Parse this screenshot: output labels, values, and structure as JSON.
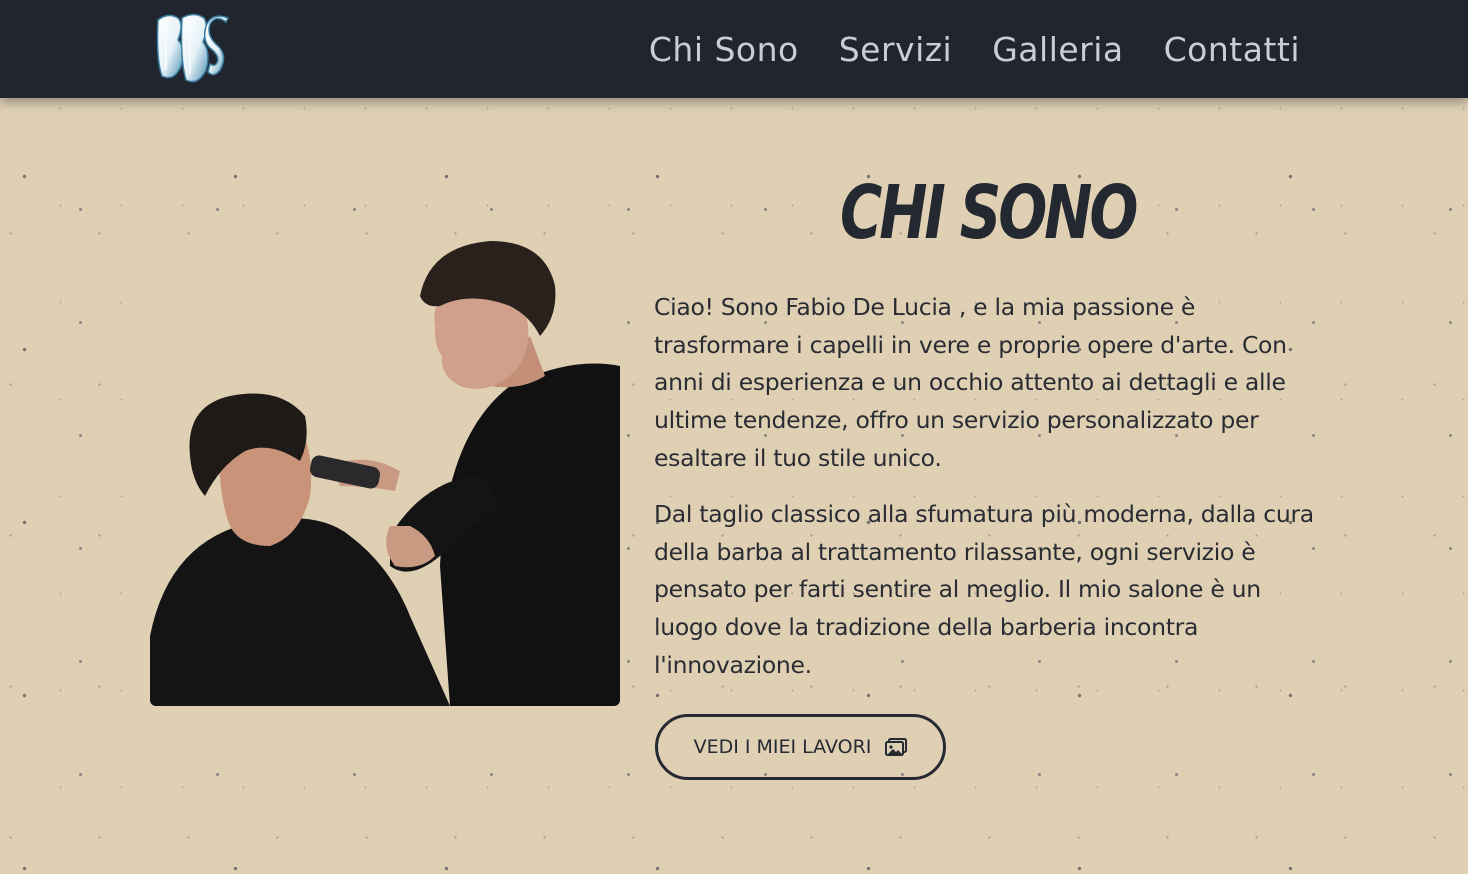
{
  "navbar": {
    "logo_text": "BBS",
    "links": [
      "Chi Sono",
      "Servizi",
      "Galleria",
      "Contatti"
    ]
  },
  "about": {
    "title": "CHI SONO",
    "paragraph1": "Ciao! Sono Fabio De Lucia , e la mia passione è trasformare i capelli in vere e proprie opere d'arte. Con anni di esperienza e un occhio attento ai dettagli e alle ultime tendenze, offro un servizio personalizzato per esaltare il tuo stile unico.",
    "paragraph2": "Dal taglio classico alla sfumatura più moderna, dalla cura della barba al trattamento rilassante, ogni servizio è pensato per farti sentire al meglio. Il mio salone è un luogo dove la tradizione della barberia incontra l'innovazione.",
    "cta_label": "VEDI I MIEI LAVORI",
    "cta_icon": "image-gallery-icon",
    "photo": "barber-cutting-client-hair"
  },
  "colors": {
    "navbar_bg": "#20252f",
    "page_bg": "#dfd0b4",
    "text_dark": "#242830",
    "nav_text": "#c9cdd4"
  }
}
